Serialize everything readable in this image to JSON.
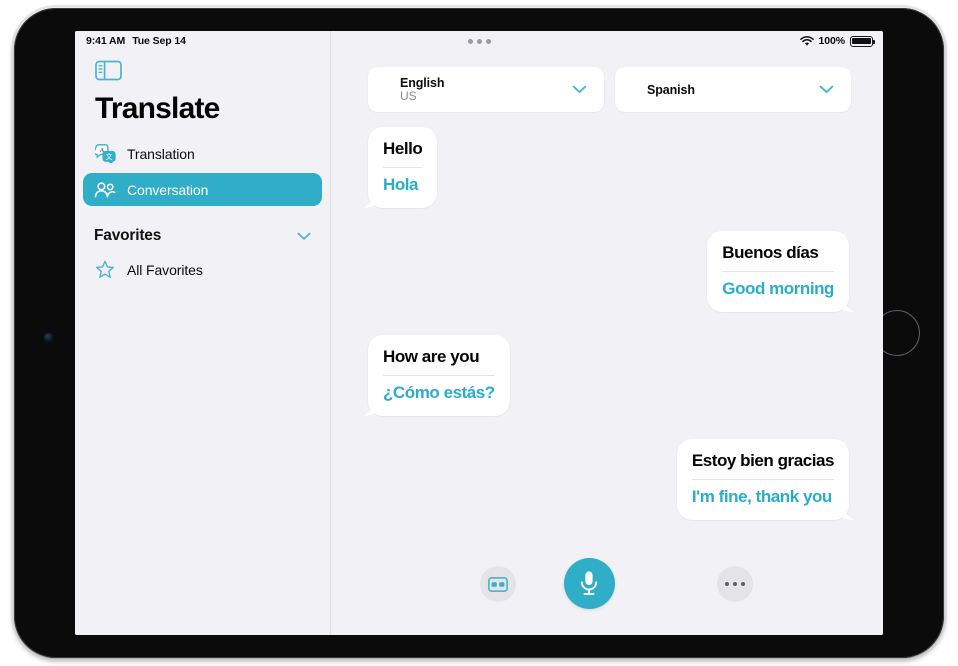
{
  "status_bar": {
    "time": "9:41 AM",
    "date": "Tue Sep 14",
    "battery_percent": "100%",
    "wifi_icon": "wifi-icon",
    "battery_icon": "battery-full-icon",
    "multitask_icon": "multitasking-dots-icon"
  },
  "sidebar": {
    "toggle_icon": "sidebar-toggle-icon",
    "app_title": "Translate",
    "items": [
      {
        "label": "Translation",
        "icon": "translation-bubbles-icon",
        "selected": false
      },
      {
        "label": "Conversation",
        "icon": "two-people-icon",
        "selected": true
      }
    ],
    "section": {
      "title": "Favorites",
      "chevron_icon": "chevron-down-icon",
      "items": [
        {
          "label": "All Favorites",
          "icon": "star-icon"
        }
      ]
    }
  },
  "main": {
    "language_from": {
      "name": "English",
      "region": "US",
      "chevron_icon": "chevron-down-icon"
    },
    "language_to": {
      "name": "Spanish",
      "region": "",
      "chevron_icon": "chevron-down-icon"
    },
    "messages": [
      {
        "side": "left",
        "source": "Hello",
        "translation": "Hola"
      },
      {
        "side": "right",
        "source": "Buenos días",
        "translation": "Good morning"
      },
      {
        "side": "left",
        "source": "How are you",
        "translation": "¿Cómo estás?"
      },
      {
        "side": "right",
        "source": "Estoy bien gracias",
        "translation": "I'm fine, thank you"
      }
    ],
    "toolbar": {
      "view_button_icon": "side-by-side-view-icon",
      "mic_button_icon": "microphone-icon",
      "more_button_icon": "more-ellipsis-icon"
    }
  },
  "colors": {
    "accent": "#30adc7",
    "translation_text": "#2aadca",
    "screen_bg": "#f2f2f6",
    "bubble_bg": "#ffffff"
  }
}
